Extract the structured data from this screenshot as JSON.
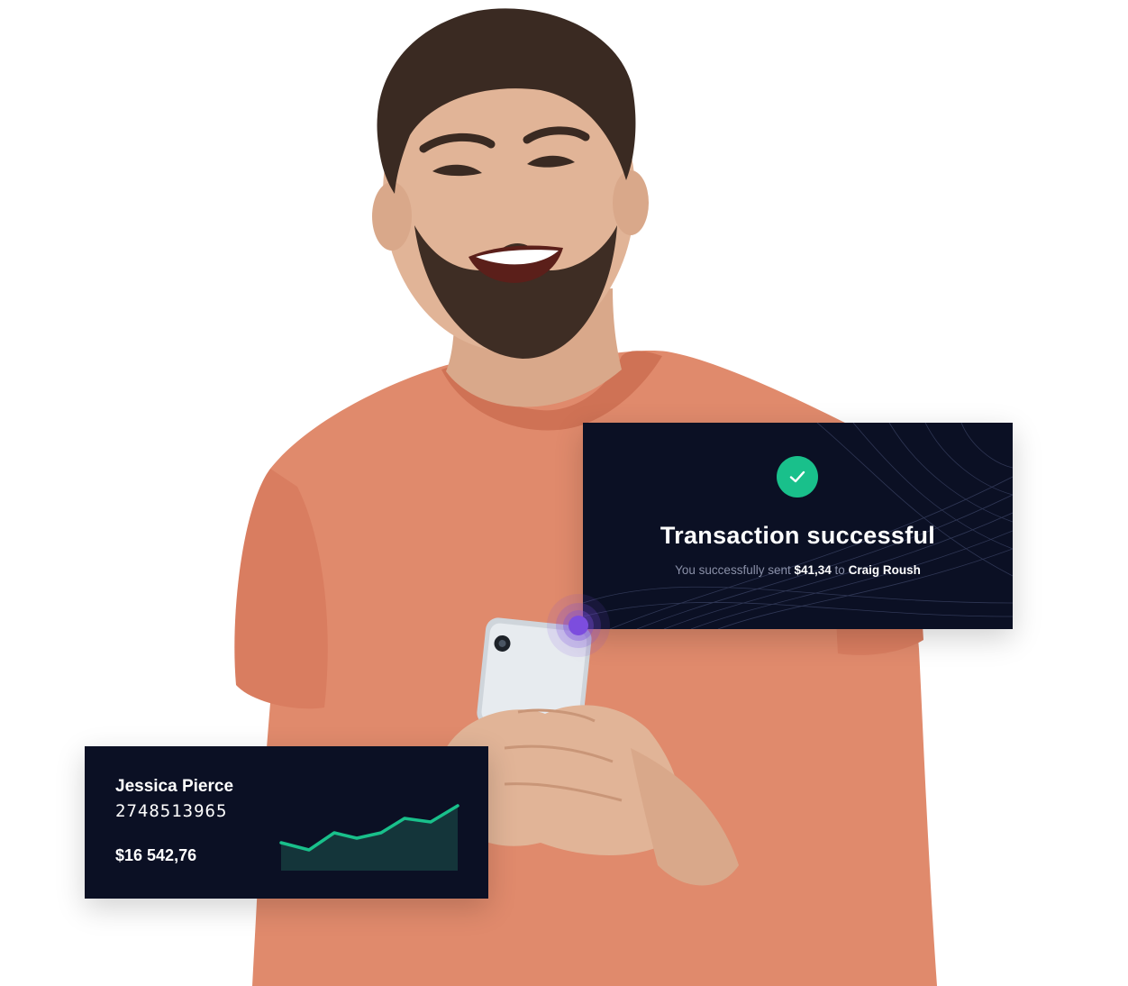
{
  "transaction": {
    "title": "Transaction successful",
    "prefix": "You successfully sent",
    "amount": "$41,34",
    "to_word": "to",
    "recipient": "Craig Roush"
  },
  "account": {
    "name": "Jessica Pierce",
    "number": "2748513965",
    "balance": "$16 542,76"
  },
  "colors": {
    "card_bg": "#0b1024",
    "success": "#19c08b",
    "sparkline": "#19c08b",
    "pulse": "#7c4dde",
    "shirt": "#e08a6c"
  },
  "icons": {
    "check": "check-icon",
    "pulse": "pulse-dot-icon"
  }
}
